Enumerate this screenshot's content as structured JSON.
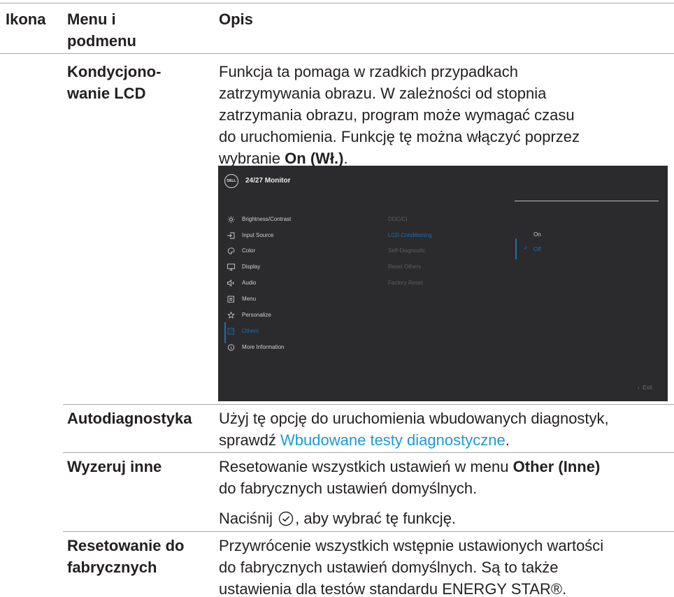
{
  "header": {
    "col_icon": "Ikona",
    "col_menu_line1": "Menu i",
    "col_menu_line2": "podmenu",
    "col_desc": "Opis"
  },
  "rows": {
    "lcd": {
      "name_line1": "Kondycjono-",
      "name_line2": "wanie LCD",
      "desc_line1": "Funkcja ta pomaga w rzadkich przypadkach",
      "desc_line2": "zatrzymywania obrazu. W zależności od stopnia",
      "desc_line3": "zatrzymania obrazu, program może wymagać czasu",
      "desc_line4": "do uruchomienia. Funkcję tę można włączyć poprzez",
      "desc_line5_prefix": "wybranie ",
      "desc_line5_bold": "On (Wł.)",
      "desc_line5_suffix": "."
    },
    "selfdiag": {
      "name": "Autodiagnostyka",
      "desc_line1": "Użyj tę opcję do uruchomienia wbudowanych diagnostyk,",
      "desc_line2_prefix": "sprawdź ",
      "desc_line2_link": "Wbudowane testy diagnostyczne",
      "desc_line2_suffix": "."
    },
    "reset_others": {
      "name": "Wyzeruj inne",
      "desc_line1_prefix": "Resetowanie wszystkich ustawień w menu ",
      "desc_line1_bold": "Other (Inne)",
      "desc_line2": "do fabrycznych ustawień domyślnych.",
      "press_prefix": "Naciśnij",
      "press_suffix": ", aby wybrać tę funkcję."
    },
    "factory": {
      "name_line1": "Resetowanie do",
      "name_line2": "fabrycznych",
      "desc_line1": "Przywrócenie wszystkich wstępnie ustawionych wartości",
      "desc_line2": "do fabrycznych ustawień domyślnych. Są to także",
      "desc_line3": "ustawienia dla testów standardu ENERGY STAR®."
    }
  },
  "osd": {
    "logo": "DELL",
    "title": "24/27 Monitor",
    "menu": [
      {
        "label": "Brightness/Contrast",
        "icon": "sun-icon"
      },
      {
        "label": "Input Source",
        "icon": "input-icon"
      },
      {
        "label": "Color",
        "icon": "palette-icon"
      },
      {
        "label": "Display",
        "icon": "display-icon"
      },
      {
        "label": "Audio",
        "icon": "speaker-icon"
      },
      {
        "label": "Menu",
        "icon": "menu-icon"
      },
      {
        "label": "Personalize",
        "icon": "star-icon"
      },
      {
        "label": "Others",
        "icon": "others-icon"
      },
      {
        "label": "More Information",
        "icon": "info-icon"
      }
    ],
    "active_menu": "Others",
    "submenu": [
      "DDC/CI",
      "LCD Conditioning",
      "Self-Diagnostic",
      "Reset Others",
      "Factory Reset"
    ],
    "active_submenu": "LCD Conditioning",
    "options": [
      "On",
      "Off"
    ],
    "selected_option": "Off",
    "exit": "Exit",
    "accent_color": "#1f6ea8"
  }
}
